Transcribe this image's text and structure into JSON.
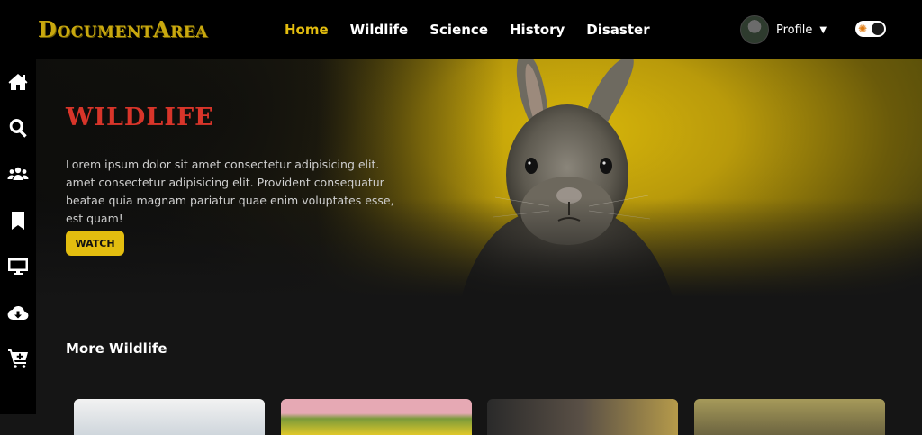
{
  "brand": {
    "logo_text": "DocumentArea",
    "accent": "#e3bd0f"
  },
  "nav": {
    "links": [
      {
        "label": "Home",
        "active": true
      },
      {
        "label": "Wildlife",
        "active": false
      },
      {
        "label": "Science",
        "active": false
      },
      {
        "label": "History",
        "active": false
      },
      {
        "label": "Disaster",
        "active": false
      }
    ],
    "profile_label": "Profile",
    "theme_toggle": {
      "state": "dark"
    }
  },
  "sidebar": {
    "items": [
      {
        "icon": "home-icon"
      },
      {
        "icon": "search-icon"
      },
      {
        "icon": "users-icon"
      },
      {
        "icon": "bookmark-icon"
      },
      {
        "icon": "monitor-icon"
      },
      {
        "icon": "cloud-download-icon"
      },
      {
        "icon": "cart-plus-icon"
      }
    ]
  },
  "hero": {
    "title": "Wildlife",
    "description": "Lorem ipsum dolor sit amet consectetur adipisicing elit. amet consectetur adipisicing elit. Provident consequatur beatae quia magnam pariatur quae enim voluptates esse, est quam!",
    "cta_label": "WATCH",
    "title_color": "#d8352a"
  },
  "more": {
    "title": "More Wildlife",
    "thumbnails": [
      {
        "name": "thumb-1"
      },
      {
        "name": "thumb-2"
      },
      {
        "name": "thumb-3"
      },
      {
        "name": "thumb-4"
      }
    ]
  }
}
